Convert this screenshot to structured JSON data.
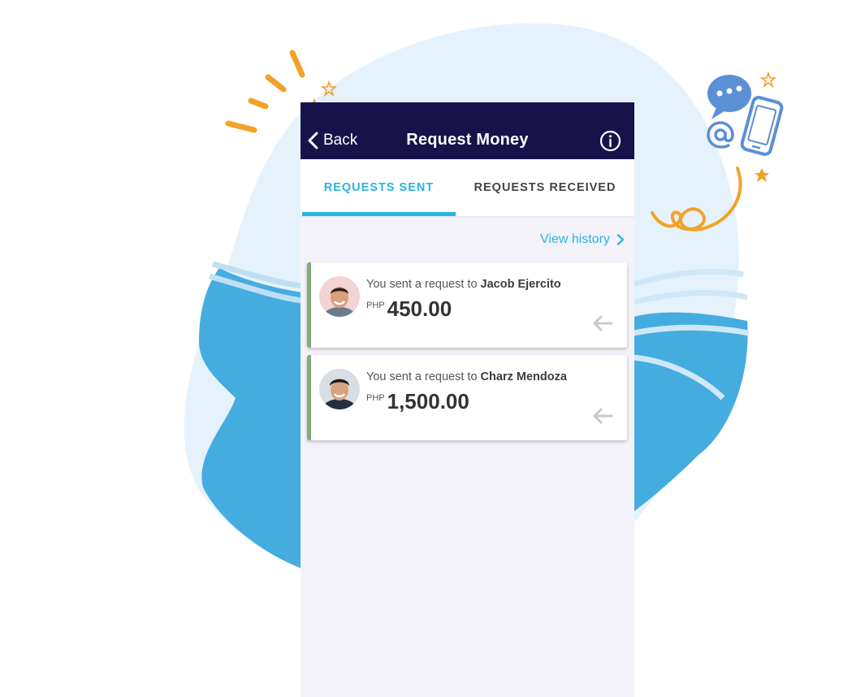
{
  "header": {
    "back_label": "Back",
    "title": "Request Money",
    "bg_color": "#17134a"
  },
  "tabs": [
    {
      "label": "REQUESTS SENT",
      "active": true
    },
    {
      "label": "REQUESTS RECEIVED",
      "active": false
    }
  ],
  "view_history": {
    "label": "View history"
  },
  "requests": [
    {
      "prefix": "You sent a request to",
      "name": "Jacob Ejercito",
      "currency": "PHP",
      "amount": "450.00"
    },
    {
      "prefix": "You sent a request to",
      "name": "Charz Mendoza",
      "currency": "PHP",
      "amount": "1,500.00"
    }
  ],
  "colors": {
    "accent": "#2bb3e3",
    "card_border": "#86a97c",
    "blob_blue": "#45ace0",
    "doodle_orange": "#f2a226",
    "doodle_blue": "#5b8fd6"
  }
}
